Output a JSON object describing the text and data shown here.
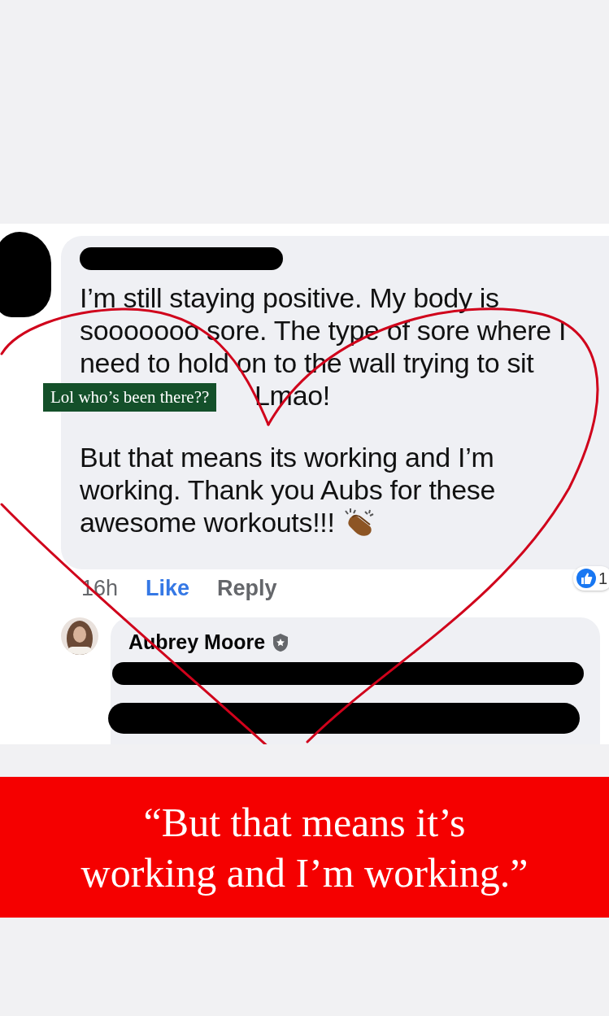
{
  "comment": {
    "paragraphs": [
      "I’m still staying positive. My body is sooooooo sore. The type of sore where I need to hold on to the wall trying to sit",
      "Lmao!",
      "But that means its working and I’m working. Thank you Aubs for these awesome workouts!!!"
    ],
    "time": "16h",
    "actions": [
      {
        "label": "Like",
        "selected": true
      },
      {
        "label": "Reply",
        "selected": false
      }
    ],
    "reaction_count": "1"
  },
  "sticker": {
    "text": "Lol who’s been there??"
  },
  "reply": {
    "author": "Aubrey Moore"
  },
  "banner": {
    "lines": [
      "“But that means it’s",
      "working and I’m working.”"
    ]
  }
}
